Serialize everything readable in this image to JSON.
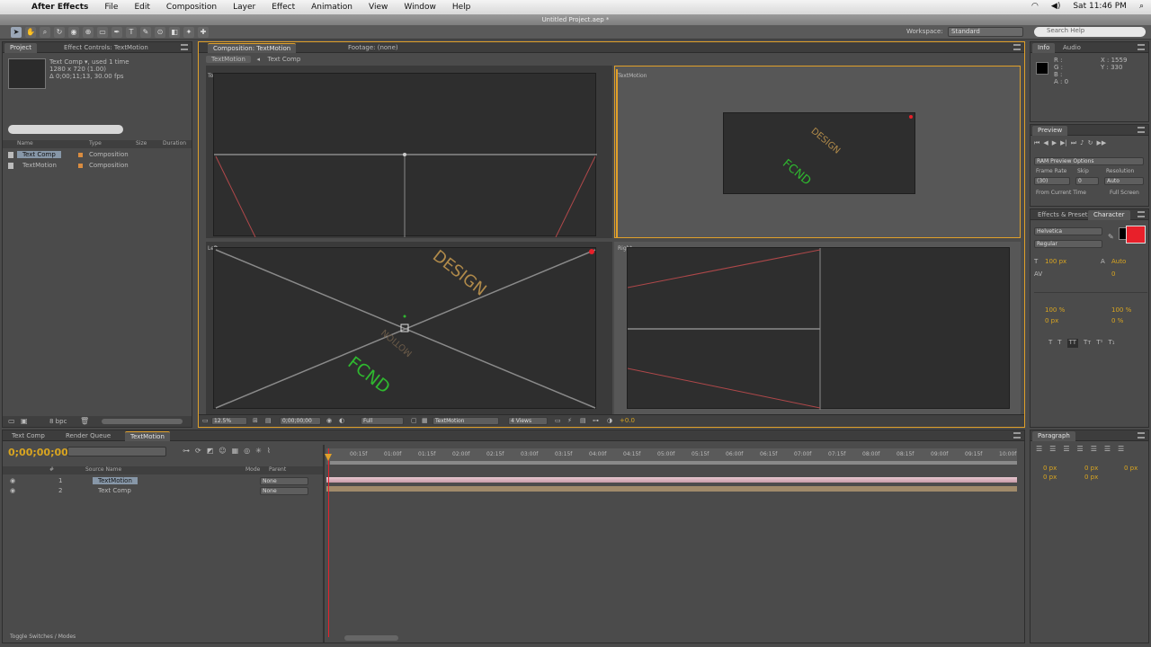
{
  "menubar": {
    "app_name": "After Effects",
    "items": [
      "File",
      "Edit",
      "Composition",
      "Layer",
      "Effect",
      "Animation",
      "View",
      "Window",
      "Help"
    ],
    "clock": "Sat 11:46 PM"
  },
  "window_title": "Untitled Project.aep *",
  "toolbar": {
    "workspace_label": "Workspace:",
    "workspace_value": "Standard",
    "search_placeholder": "Search Help"
  },
  "project_panel": {
    "tabs": [
      "Project",
      "Effect Controls: TextMotion"
    ],
    "item_name": "Text Comp ▾, used 1 time",
    "item_info_1": "1280 x 720 (1.00)",
    "item_info_2": "Δ 0;00;11;13, 30.00 fps",
    "columns": [
      "Name",
      "Type",
      "Size",
      "Duration"
    ],
    "rows": [
      {
        "name": "Text Comp",
        "type": "Composition",
        "selected": true
      },
      {
        "name": "TextMotion",
        "type": "Composition",
        "selected": false
      }
    ],
    "bpc": "8 bpc"
  },
  "composition_panel": {
    "tab": "Composition: TextMotion",
    "second_tab": "Footage: (none)",
    "nav": [
      "TextMotion",
      "Text Comp"
    ],
    "views": {
      "top": "Top",
      "camera": "TextMotion",
      "left": "Left",
      "right": "Right"
    },
    "bottom_bar": {
      "zoom": "12.5%",
      "timecode": "0;00;00;00",
      "resolution": "Full",
      "camera": "TextMotion",
      "view_layout": "4 Views",
      "exposure": "+0.0"
    }
  },
  "info_panel": {
    "tabs": [
      "Info",
      "Audio"
    ],
    "values": [
      "R :",
      "G :",
      "B :",
      "A : 0"
    ],
    "coords": [
      "X : 1559",
      "Y : 330"
    ]
  },
  "preview_panel": {
    "tab": "Preview",
    "ram_preview": "RAM Preview Options",
    "labels": [
      "Frame Rate",
      "Skip",
      "Resolution"
    ],
    "values": [
      "(30)",
      "0",
      "Auto"
    ],
    "from_current": "From Current Time",
    "full_screen": "Full Screen"
  },
  "character_panel": {
    "tabs": [
      "Effects & Presets",
      "Character"
    ],
    "font": "Helvetica",
    "style": "Regular",
    "size": "100 px",
    "leading": "Auto",
    "fill_color": "#e8202a",
    "tracking_values": [
      "0",
      "100 %",
      "100 %",
      "0 px",
      "0 %"
    ]
  },
  "paragraph_panel": {
    "tab": "Paragraph",
    "values": [
      "0 px",
      "0 px",
      "0 px",
      "0 px",
      "0 px"
    ]
  },
  "timeline": {
    "tabs": [
      "Text Comp",
      "Render Queue",
      "TextMotion"
    ],
    "timecode": "0;00;00;00",
    "column_headers": [
      "#",
      "Source Name",
      "Mode",
      "Parent"
    ],
    "layers": [
      {
        "num": "1",
        "name": "TextMotion",
        "parent": "None",
        "selected": true
      },
      {
        "num": "2",
        "name": "Text Comp",
        "parent": "None",
        "selected": false
      }
    ],
    "ruler_marks": [
      "00:15f",
      "01:00f",
      "01:15f",
      "02:00f",
      "02:15f",
      "03:00f",
      "03:15f",
      "04:00f",
      "04:15f",
      "05:00f",
      "05:15f",
      "06:00f",
      "06:15f",
      "07:00f",
      "07:15f",
      "08:00f",
      "08:15f",
      "09:00f",
      "09:15f",
      "10:00f"
    ],
    "footer": "Toggle Switches / Modes"
  },
  "scene_text": {
    "design": "DESIGN",
    "scond": "FCND",
    "motion": "MOTION"
  },
  "colors": {
    "accent_gold": "#e0a02a",
    "green_text": "#2fb82f",
    "red": "#e8202a"
  }
}
